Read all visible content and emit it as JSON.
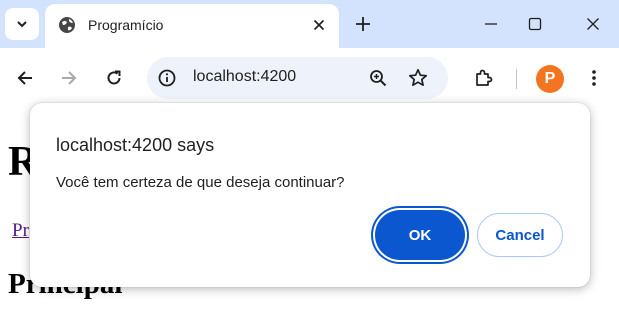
{
  "browser": {
    "tab": {
      "title": "Programício"
    },
    "address_bar": {
      "url": "localhost:4200"
    },
    "profile_initial": "P",
    "accent_color": "#0b57d0",
    "tabstrip_color": "#d3e3fd"
  },
  "page": {
    "heading": "R",
    "link_text": "Pr",
    "subheading": "Principal"
  },
  "dialog": {
    "title": "localhost:4200 says",
    "message": "Você tem certeza de que deseja continuar?",
    "ok_label": "OK",
    "cancel_label": "Cancel"
  },
  "icons": [
    "chevron-down-icon",
    "globe-icon",
    "close-icon",
    "plus-icon",
    "minimize-icon",
    "maximize-icon",
    "back-icon",
    "forward-icon",
    "reload-icon",
    "info-icon",
    "zoom-icon",
    "star-icon",
    "extensions-icon",
    "kebab-menu-icon"
  ]
}
